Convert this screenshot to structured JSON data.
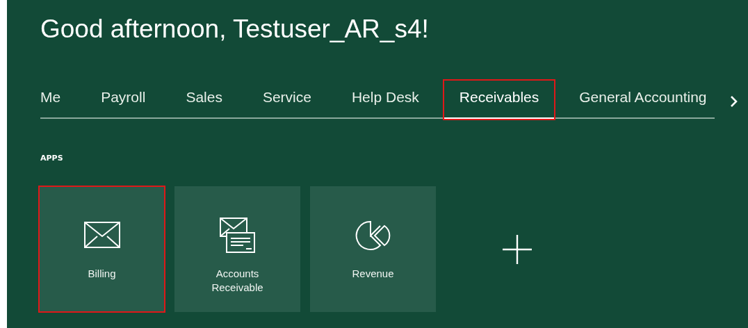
{
  "greeting": "Good afternoon, Testuser_AR_s4!",
  "tabs": [
    {
      "label": "Me",
      "selected": false,
      "highlighted": false
    },
    {
      "label": "Payroll",
      "selected": false,
      "highlighted": false
    },
    {
      "label": "Sales",
      "selected": false,
      "highlighted": false
    },
    {
      "label": "Service",
      "selected": false,
      "highlighted": false
    },
    {
      "label": "Help Desk",
      "selected": false,
      "highlighted": false
    },
    {
      "label": "Receivables",
      "selected": true,
      "highlighted": true
    },
    {
      "label": "General Accounting",
      "selected": false,
      "highlighted": false
    }
  ],
  "section_label": "APPS",
  "apps": [
    {
      "kind": "envelope",
      "label": "Billing",
      "highlighted": true
    },
    {
      "kind": "envelope-card",
      "label": "Accounts Receivable",
      "highlighted": false
    },
    {
      "kind": "pie",
      "label": "Revenue",
      "highlighted": false
    }
  ]
}
